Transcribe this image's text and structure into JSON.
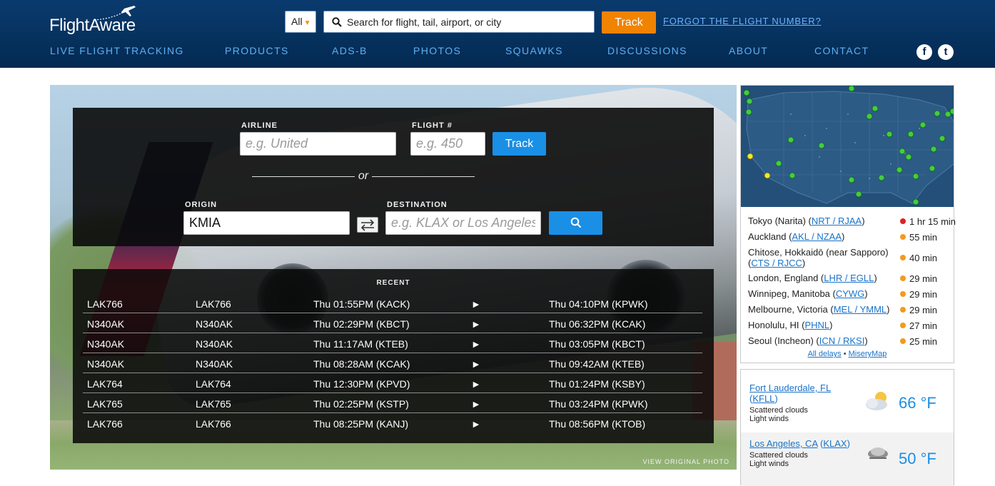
{
  "header": {
    "logo": "FlightAware",
    "scope": "All",
    "search_placeholder": "Search for flight, tail, airport, or city",
    "track_label": "Track",
    "forgot_link": "FORGOT THE FLIGHT NUMBER?",
    "nav": [
      "LIVE FLIGHT TRACKING",
      "PRODUCTS",
      "ADS-B",
      "PHOTOS",
      "SQUAWKS",
      "DISCUSSIONS",
      "ABOUT",
      "CONTACT"
    ],
    "social": {
      "facebook": "f",
      "twitter": "t"
    }
  },
  "search": {
    "airline_label": "AIRLINE",
    "airline_placeholder": "e.g. United",
    "flight_label": "FLIGHT #",
    "flight_placeholder": "e.g. 450",
    "track_label": "Track",
    "or_text": "or",
    "origin_label": "ORIGIN",
    "origin_value": "KMIA",
    "destination_label": "DESTINATION",
    "destination_placeholder": "e.g. KLAX or Los Angeles"
  },
  "recent": {
    "title": "RECENT",
    "arrow": "►",
    "rows": [
      {
        "ident": "LAK766",
        "reg": "LAK766",
        "dep": "Thu 01:55PM (KACK)",
        "arr": "Thu 04:10PM (KPWK)"
      },
      {
        "ident": "N340AK",
        "reg": "N340AK",
        "dep": "Thu 02:29PM (KBCT)",
        "arr": "Thu 06:32PM (KCAK)"
      },
      {
        "ident": "N340AK",
        "reg": "N340AK",
        "dep": "Thu 11:17AM (KTEB)",
        "arr": "Thu 03:05PM (KBCT)"
      },
      {
        "ident": "N340AK",
        "reg": "N340AK",
        "dep": "Thu 08:28AM (KCAK)",
        "arr": "Thu 09:42AM (KTEB)"
      },
      {
        "ident": "LAK764",
        "reg": "LAK764",
        "dep": "Thu 12:30PM (KPVD)",
        "arr": "Thu 01:24PM (KSBY)"
      },
      {
        "ident": "LAK765",
        "reg": "LAK765",
        "dep": "Thu 02:25PM (KSTP)",
        "arr": "Thu 03:24PM (KPWK)"
      },
      {
        "ident": "LAK766",
        "reg": "LAK766",
        "dep": "Thu 08:25PM (KANJ)",
        "arr": "Thu 08:56PM (KTOB)"
      }
    ]
  },
  "hero": {
    "view_original": "VIEW ORIGINAL PHOTO"
  },
  "delays": {
    "items": [
      {
        "city": "Tokyo (Narita) (",
        "code": "NRT / RJAA",
        "end": ")",
        "time": "1 hr 15 min",
        "color": "#e02020"
      },
      {
        "city": "Auckland (",
        "code": "AKL / NZAA",
        "end": ")",
        "time": "55 min",
        "color": "#f39a1e"
      },
      {
        "city": "Chitose, Hokkaidō (near Sapporo) (",
        "code": "CTS / RJCC",
        "end": ")",
        "time": "40 min",
        "color": "#f39a1e"
      },
      {
        "city": "London, England (",
        "code": "LHR / EGLL",
        "end": ")",
        "time": "29 min",
        "color": "#f39a1e"
      },
      {
        "city": "Winnipeg, Manitoba (",
        "code": "CYWG",
        "end": ")",
        "time": "29 min",
        "color": "#f39a1e"
      },
      {
        "city": "Melbourne, Victoria (",
        "code": "MEL / YMML",
        "end": ")",
        "time": "29 min",
        "color": "#f39a1e"
      },
      {
        "city": "Honolulu, HI (",
        "code": "PHNL",
        "end": ")",
        "time": "27 min",
        "color": "#f39a1e"
      },
      {
        "city": "Seoul (Incheon) (",
        "code": "ICN / RKSI",
        "end": ")",
        "time": "25 min",
        "color": "#f39a1e"
      }
    ],
    "all_delays": "All delays",
    "separator": " • ",
    "misery_map": "MiseryMap"
  },
  "weather": [
    {
      "city": "Fort Lauderdale, FL",
      "code": "KFLL",
      "desc1": "Scattered clouds",
      "desc2": "Light winds",
      "temp": "66 °F"
    },
    {
      "city": "Los Angeles, CA",
      "code": "KLAX",
      "desc1": "Scattered clouds",
      "desc2": "Light winds",
      "temp": "50 °F"
    }
  ]
}
